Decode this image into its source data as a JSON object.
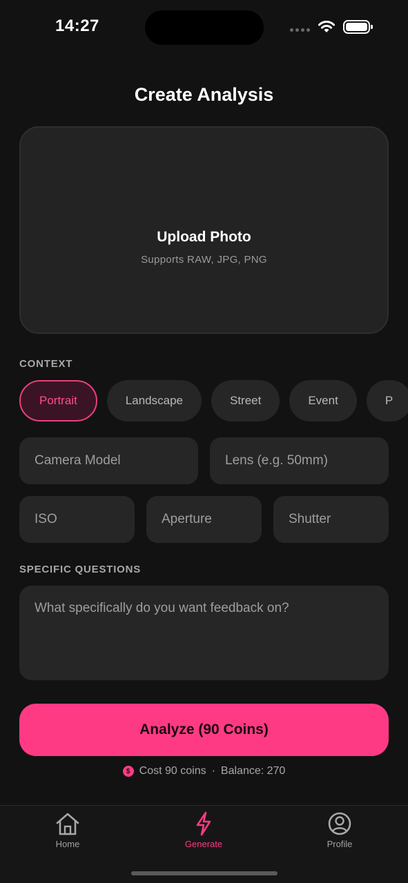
{
  "status_bar": {
    "time": "14:27"
  },
  "header": {
    "title": "Create Analysis"
  },
  "upload": {
    "title": "Upload Photo",
    "subtitle": "Supports RAW, JPG, PNG"
  },
  "context": {
    "label": "CONTEXT",
    "chips": [
      {
        "label": "Portrait",
        "active": true
      },
      {
        "label": "Landscape",
        "active": false
      },
      {
        "label": "Street",
        "active": false
      },
      {
        "label": "Event",
        "active": false
      },
      {
        "label": "P",
        "active": false
      }
    ]
  },
  "fields": {
    "camera_model_placeholder": "Camera Model",
    "lens_placeholder": "Lens (e.g. 50mm)",
    "iso_placeholder": "ISO",
    "aperture_placeholder": "Aperture",
    "shutter_placeholder": "Shutter"
  },
  "questions": {
    "label": "SPECIFIC QUESTIONS",
    "placeholder": "What specifically do you want feedback on?"
  },
  "action": {
    "analyze_label": "Analyze (90 Coins)",
    "coin_symbol": "$",
    "cost_text": "Cost 90 coins",
    "separator": "·",
    "balance_text": "Balance: 270"
  },
  "tab_bar": {
    "tabs": [
      {
        "label": "Home",
        "icon": "home-icon",
        "active": false
      },
      {
        "label": "Generate",
        "icon": "lightning-icon",
        "active": true
      },
      {
        "label": "Profile",
        "icon": "profile-icon",
        "active": false
      }
    ]
  },
  "colors": {
    "background": "#121212",
    "accent": "#ff3a84",
    "surface": "#262626",
    "text_secondary": "#9e9e9e"
  }
}
